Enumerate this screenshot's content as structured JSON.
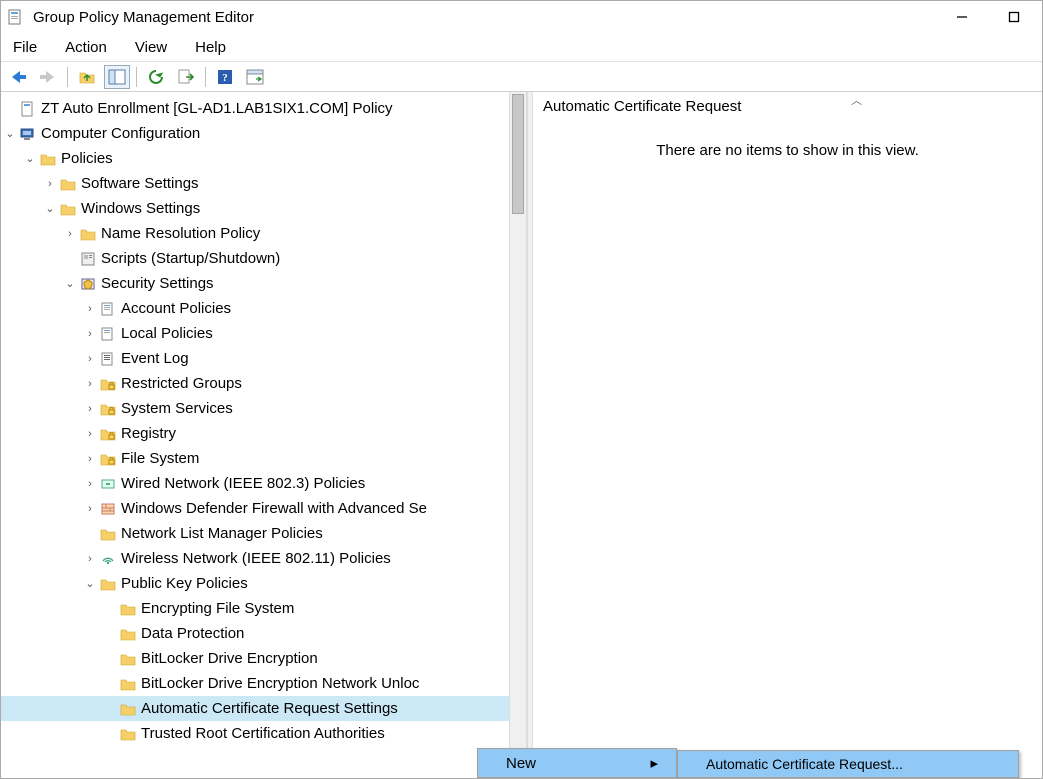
{
  "window": {
    "title": "Group Policy Management Editor"
  },
  "menu": {
    "file": "File",
    "action": "Action",
    "view": "View",
    "help": "Help"
  },
  "content": {
    "header": "Automatic Certificate Request",
    "empty": "There are no items to show in this view."
  },
  "context": {
    "new": "New",
    "sub_acr": "Automatic Certificate Request..."
  },
  "tree": {
    "root": "ZT Auto Enrollment [GL-AD1.LAB1SIX1.COM] Policy",
    "comp_cfg": "Computer Configuration",
    "policies": "Policies",
    "soft_settings": "Software Settings",
    "win_settings": "Windows Settings",
    "nrp": "Name Resolution Policy",
    "scripts": "Scripts (Startup/Shutdown)",
    "sec_settings": "Security Settings",
    "account_pol": "Account Policies",
    "local_pol": "Local Policies",
    "event_log": "Event Log",
    "restricted_groups": "Restricted Groups",
    "system_services": "System Services",
    "registry": "Registry",
    "file_system": "File System",
    "wired": "Wired Network (IEEE 802.3) Policies",
    "defender": "Windows Defender Firewall with Advanced Se",
    "nlmp": "Network List Manager Policies",
    "wireless": "Wireless Network (IEEE 802.11) Policies",
    "pkp": "Public Key Policies",
    "efs": "Encrypting File System",
    "data_prot": "Data Protection",
    "bitlocker": "BitLocker Drive Encryption",
    "bitlocker_net": "BitLocker Drive Encryption Network Unloc",
    "acr_settings": "Automatic Certificate Request Settings",
    "trusted_root": "Trusted Root Certification Authorities"
  }
}
